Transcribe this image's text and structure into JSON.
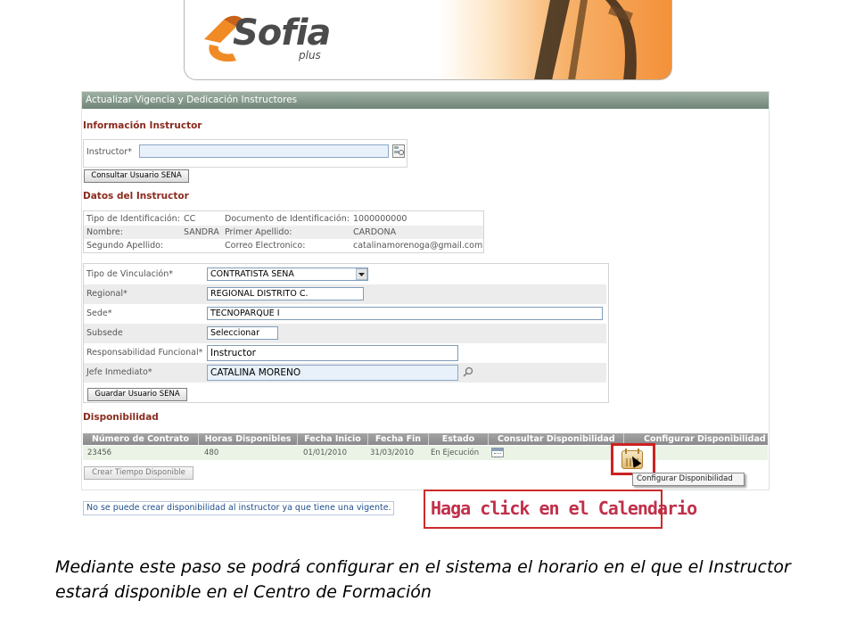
{
  "banner": {
    "logo_text": "Sofia",
    "logo_sub": "plus"
  },
  "app": {
    "title": "Actualizar Vigencia y Dedicación Instructores",
    "info_section_title": "Información Instructor",
    "instructor_label": "Instructor*",
    "instructor_value": "",
    "consultar_button": "Consultar Usuario SENA",
    "datos_section_title": "Datos del Instructor",
    "datos": {
      "tipo_id_label": "Tipo de Identificación:",
      "tipo_id_value": "CC",
      "documento_label": "Documento de Identificación:",
      "documento_value": "1000000000",
      "nombre_label": "Nombre:",
      "nombre_value": "SANDRA",
      "primer_apellido_label": "Primer Apellido:",
      "primer_apellido_value": "CARDONA",
      "segundo_apellido_label": "Segundo Apellido:",
      "segundo_apellido_value": "",
      "correo_label": "Correo Electronico:",
      "correo_value": "catalinamorenoga@gmail.com"
    },
    "form": {
      "vinculacion_label": "Tipo de Vinculación*",
      "vinculacion_value": "CONTRATISTA SENA",
      "regional_label": "Regional*",
      "regional_value": "REGIONAL DISTRITO C.",
      "sede_label": "Sede*",
      "sede_value": "TECNOPARQUE I",
      "subsede_label": "Subsede",
      "subsede_value": "Seleccionar",
      "responsabilidad_label": "Responsabilidad Funcional*",
      "responsabilidad_value": "Instructor",
      "jefe_label": "Jefe Inmediato*",
      "jefe_value": "CATALINA MORENO",
      "guardar_button": "Guardar Usuario SENA"
    },
    "disponibilidad_title": "Disponibilidad",
    "grid": {
      "headers": [
        "Número de Contrato",
        "Horas Disponibles",
        "Fecha Inicio",
        "Fecha Fin",
        "Estado",
        "Consultar Disponibilidad",
        "Configurar Disponibilidad"
      ],
      "rows": [
        {
          "contrato": "23456",
          "horas": "480",
          "inicio": "01/01/2010",
          "fin": "31/03/2010",
          "estado": "En Ejecución"
        }
      ]
    },
    "crear_button": "Crear Tiempo Disponible",
    "tooltip": "Configurar Disponibilidad",
    "message": "No se puede crear disponibilidad al instructor ya que tiene una vigente."
  },
  "callout": "Haga click en el Calendario",
  "caption": "Mediante este paso se podrá configurar en el sistema el horario en el que el Instructor estará disponible en el Centro de Formación",
  "colors": {
    "accent_orange": "#f3913a",
    "section_title": "#8a2b1e",
    "highlight_red": "#cc2222",
    "message_blue": "#1f4e8c"
  }
}
